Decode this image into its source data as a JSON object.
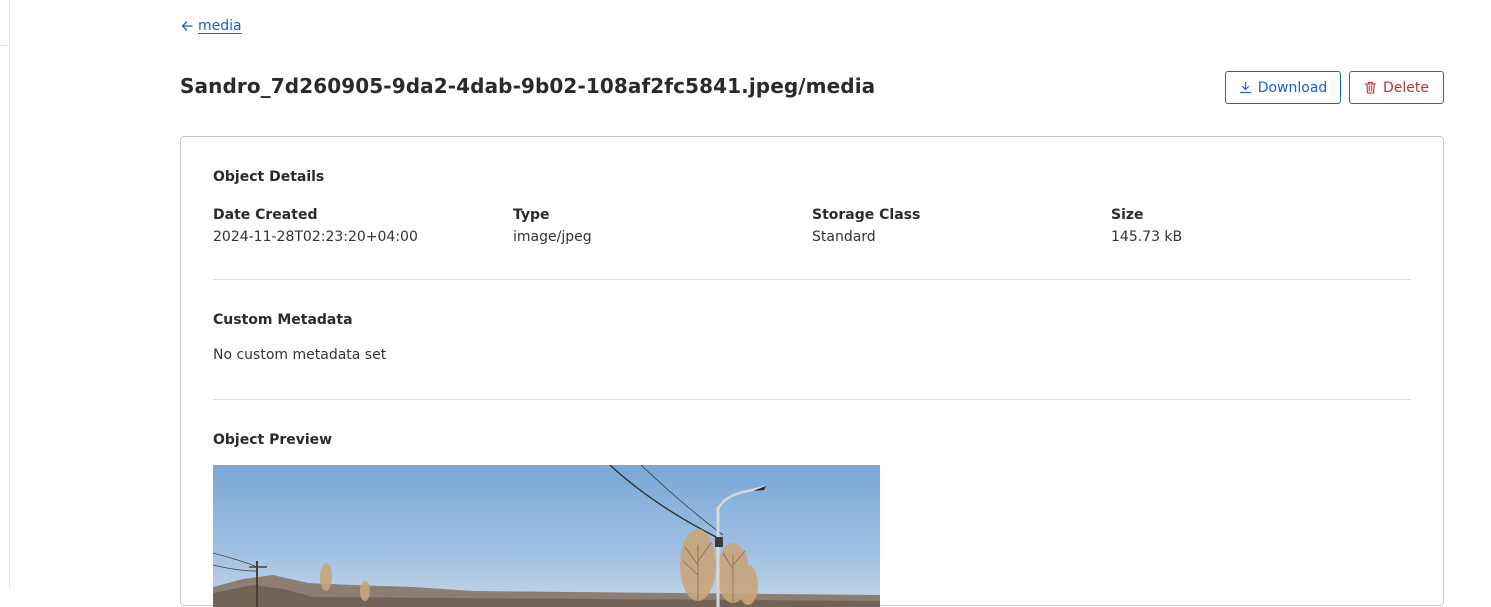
{
  "nav": {
    "back_label": "media"
  },
  "header": {
    "title": "Sandro_7d260905-9da2-4dab-9b02-108af2fc5841.jpeg/media",
    "download_label": "Download",
    "delete_label": "Delete"
  },
  "details": {
    "section_title": "Object Details",
    "fields": [
      {
        "label": "Date Created",
        "value": "2024-11-28T02:23:20+04:00"
      },
      {
        "label": "Type",
        "value": "image/jpeg"
      },
      {
        "label": "Storage Class",
        "value": "Standard"
      },
      {
        "label": "Size",
        "value": "145.73 kB"
      }
    ]
  },
  "custom_metadata": {
    "section_title": "Custom Metadata",
    "empty_text": "No custom metadata set"
  },
  "preview": {
    "section_title": "Object Preview"
  },
  "colors": {
    "primary": "#1a62c7",
    "danger": "#c7302a"
  },
  "icons": {
    "back": "arrow-left-icon",
    "download": "download-icon",
    "delete": "trash-icon"
  }
}
